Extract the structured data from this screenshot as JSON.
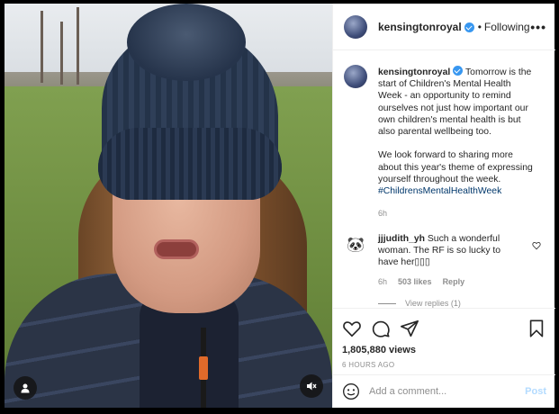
{
  "header": {
    "username": "kensingtonroyal",
    "separator": "•",
    "follow_status": "Following",
    "more_icon": "more-horizontal-icon"
  },
  "caption": {
    "username": "kensingtonroyal",
    "text_1": "Tomorrow is the start of Children's Mental Health Week - an opportunity to remind ourselves not just how important our own children's mental health is but also parental wellbeing too.",
    "text_2": "We look forward to sharing more about this year's theme of expressing yourself throughout the week.",
    "hashtag": "#ChildrensMentalHealthWeek",
    "age": "6h"
  },
  "comments": [
    {
      "avatar_emoji": "🐼",
      "username": "jjjudith_yh",
      "text": "Such a wonderful woman. The RF is so lucky to have her▯▯▯",
      "age": "6h",
      "likes": "503 likes",
      "reply_label": "Reply",
      "view_replies": "View replies (1)"
    }
  ],
  "stats": {
    "views": "1,805,880 views",
    "posted": "6 HOURS AGO"
  },
  "add_comment": {
    "placeholder": "Add a comment...",
    "post_label": "Post"
  },
  "colors": {
    "link_blue": "#00376b",
    "verified_blue": "#3897f0",
    "post_disabled": "#b3dbff",
    "muted_text": "#8e8e8e"
  }
}
